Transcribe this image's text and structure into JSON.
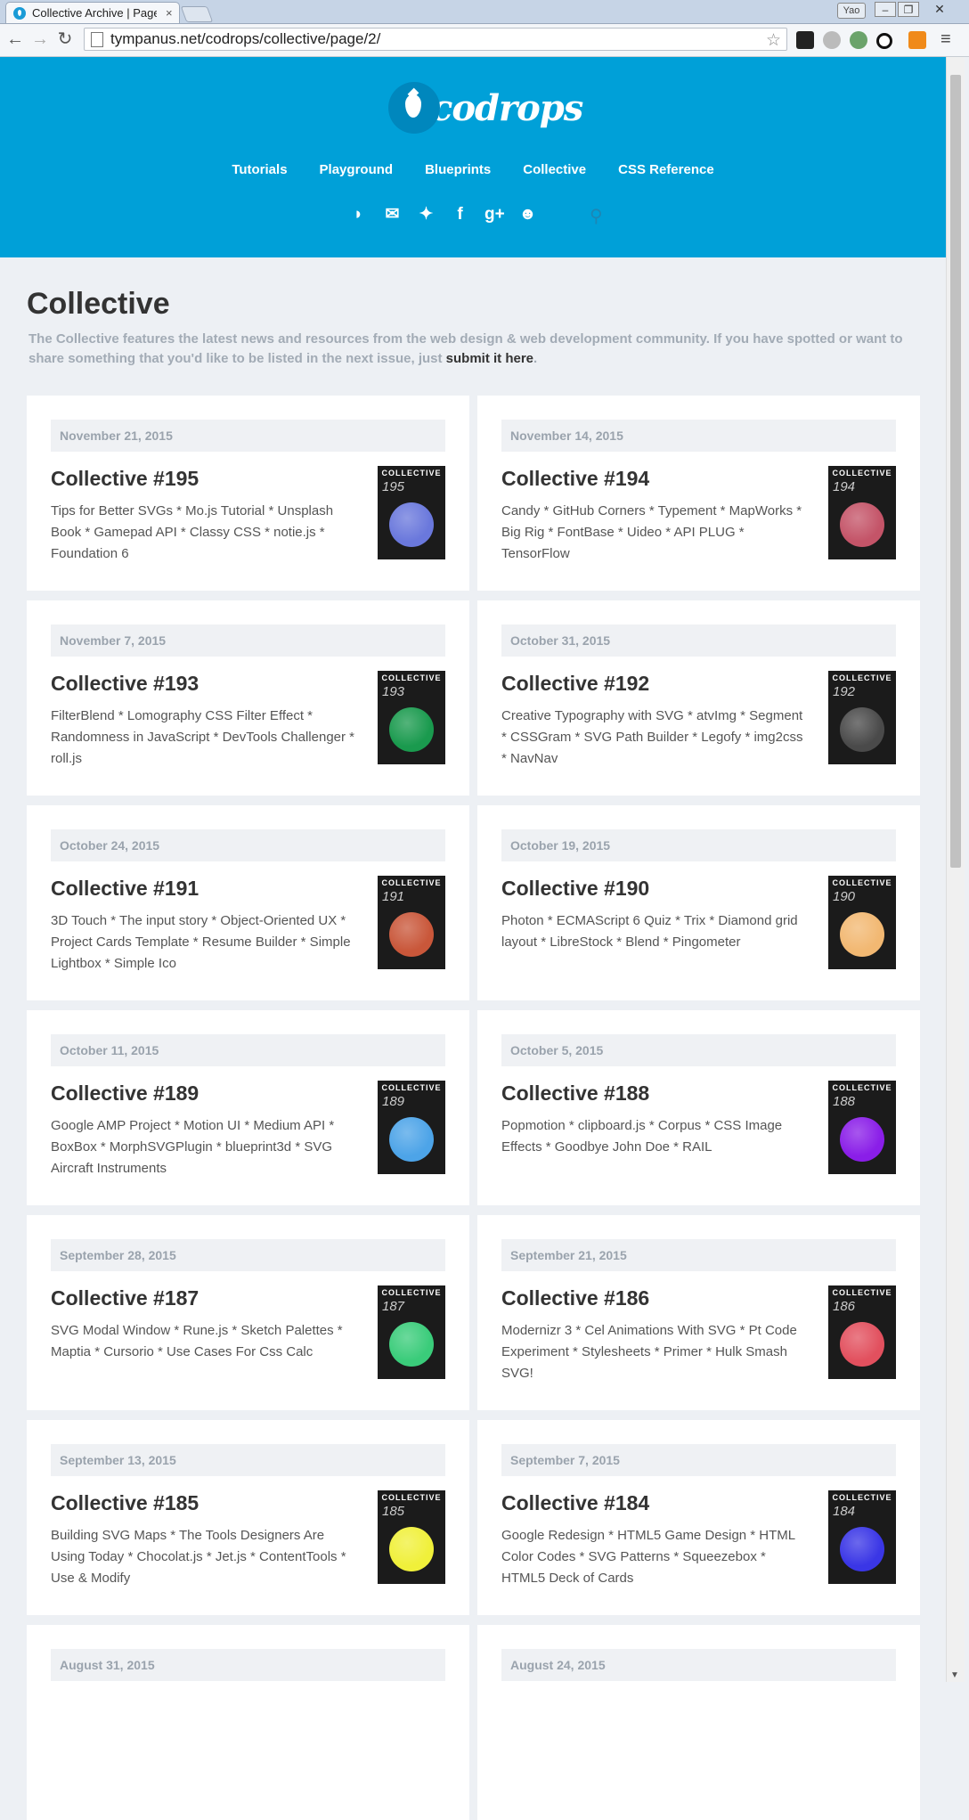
{
  "browser": {
    "tab_title": "Collective Archive | Page",
    "tab_close": "×",
    "user_button": "Yao",
    "url": "tympanus.net/codrops/collective/page/2/"
  },
  "site": {
    "logo_text": "codrops",
    "nav": [
      "Tutorials",
      "Playground",
      "Blueprints",
      "Collective",
      "CSS Reference"
    ],
    "social_icons": [
      "rss-icon",
      "mail-icon",
      "twitter-icon",
      "facebook-icon",
      "google-plus-icon",
      "github-icon"
    ]
  },
  "page": {
    "title": "Collective",
    "intro": "The Collective features the latest news and resources from the web design & web development community. If you have spotted or want to share something that you'd like to be listed in the next issue, just ",
    "intro_link": "submit it here",
    "intro_end": "."
  },
  "thumb_label": "COLLECTIVE",
  "cards": [
    {
      "date": "November 21, 2015",
      "title": "Collective #195",
      "desc": "Tips for Better SVGs * Mo.js Tutorial * Unsplash Book * Gamepad API * Classy CSS * notie.js * Foundation 6",
      "num": "195",
      "color": "#6a78dc"
    },
    {
      "date": "November 14, 2015",
      "title": "Collective #194",
      "desc": "Candy * GitHub Corners * Typement * MapWorks * Big Rig * FontBase * Uideo * API PLUG * TensorFlow",
      "num": "194",
      "color": "#c45468"
    },
    {
      "date": "November 7, 2015",
      "title": "Collective #193",
      "desc": "FilterBlend * Lomography CSS Filter Effect * Randomness in JavaScript * DevTools Challenger * roll.js",
      "num": "193",
      "color": "#1a9a4e"
    },
    {
      "date": "October 31, 2015",
      "title": "Collective #192",
      "desc": "Creative Typography with SVG * atvImg * Segment * CSSGram * SVG Path Builder * Legofy * img2css * NavNav",
      "num": "192",
      "color": "#4a4a4a"
    },
    {
      "date": "October 24, 2015",
      "title": "Collective #191",
      "desc": "3D Touch * The input story * Object-Oriented UX * Project Cards Template * Resume Builder * Simple Lightbox * Simple Ico",
      "num": "191",
      "color": "#c9573a"
    },
    {
      "date": "October 19, 2015",
      "title": "Collective #190",
      "desc": "Photon * ECMAScript 6 Quiz * Trix * Diamond grid layout * LibreStock * Blend * Pingometer",
      "num": "190",
      "color": "#f2b872"
    },
    {
      "date": "October 11, 2015",
      "title": "Collective #189",
      "desc": "Google AMP Project * Motion UI * Medium API * BoxBox * MorphSVGPlugin * blueprint3d * SVG Aircraft Instruments",
      "num": "189",
      "color": "#4da4e8"
    },
    {
      "date": "October 5, 2015",
      "title": "Collective #188",
      "desc": "Popmotion * clipboard.js * Corpus * CSS Image Effects * Goodbye John Doe * RAIL",
      "num": "188",
      "color": "#8a1ee8"
    },
    {
      "date": "September 28, 2015",
      "title": "Collective #187",
      "desc": "SVG Modal Window * Rune.js * Sketch Palettes * Maptia * Cursorio * Use Cases For Css Calc",
      "num": "187",
      "color": "#3acc7a"
    },
    {
      "date": "September 21, 2015",
      "title": "Collective #186",
      "desc": "Modernizr 3 * Cel Animations With SVG * Pt Code Experiment * Stylesheets * Primer * Hulk Smash SVG!",
      "num": "186",
      "color": "#e2505e"
    },
    {
      "date": "September 13, 2015",
      "title": "Collective #185",
      "desc": "Building SVG Maps * The Tools Designers Are Using Today * Chocolat.js * Jet.js * ContentTools * Use & Modify",
      "num": "185",
      "color": "#f0f03a"
    },
    {
      "date": "September 7, 2015",
      "title": "Collective #184",
      "desc": "Google Redesign * HTML5 Game Design * HTML Color Codes * SVG Patterns * Squeezebox * HTML5 Deck of Cards",
      "num": "184",
      "color": "#3a36e6"
    },
    {
      "date": "August 31, 2015",
      "title": "",
      "desc": "",
      "num": "",
      "color": ""
    },
    {
      "date": "August 24, 2015",
      "title": "",
      "desc": "",
      "num": "",
      "color": ""
    }
  ]
}
